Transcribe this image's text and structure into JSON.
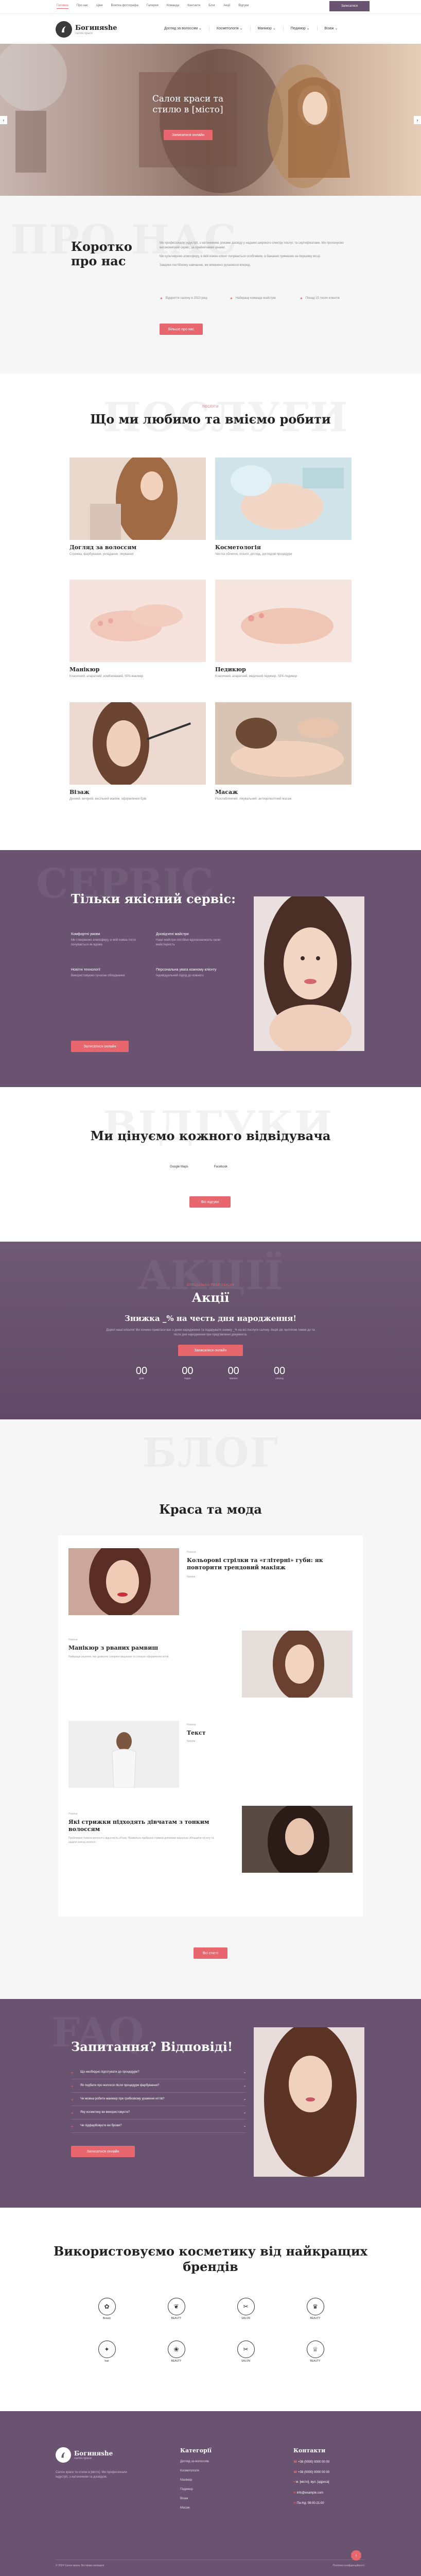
{
  "top_bar": {
    "links": [
      "Головна",
      "Про нас",
      "Ціни",
      "Візитка фотографа",
      "Галерея",
      "Команда",
      "Контакти",
      "Блог",
      "Акції",
      "Відгуки"
    ],
    "button": "Записатися"
  },
  "header": {
    "logo_name": "Богиняshe",
    "logo_sub": "салон краси",
    "nav": [
      "Догляд за волоссям",
      "Косметологія",
      "Манікюр",
      "Педикюр",
      "Візаж"
    ]
  },
  "hero": {
    "title_line1": "Салон краси та",
    "title_line2": "стилю в [місто]",
    "button": "Записатися онлайн"
  },
  "about": {
    "ghost": "ПРО НАС",
    "title_line1": "Коротко",
    "title_line2": "про нас",
    "p1": "Ми професіонали індустрії, з натхненням, роками досвіду у наданні широкого спектру послуг, та сертифікатами. Ми пропонуємо високоякісний сервіс, за прийнятними цінами.",
    "p2": "Ми культивуємо атмосферу, в якій кожен клієнт почувається особливим, а бажання тримаємо на першому місці.",
    "p3": "Завдяки постійному навчанню, ми впевнено рухаємося вперед.",
    "features": [
      "Відкриття салону в 2010 році",
      "Найкращі команда майстрів",
      "Понад 15 тисяч клієнтів"
    ],
    "button": "Більше про нас"
  },
  "services": {
    "ghost": "ПОСЛУГИ",
    "label": "Послуги",
    "title": "Що ми любимо та вміємо робити",
    "items": [
      {
        "title": "Догляд за волоссям",
        "desc": "Стрижка, фарбування, укладання, лікування"
      },
      {
        "title": "Косметологія",
        "desc": "Чистка обличчя, пілінги, догляд, доглядові процедури"
      },
      {
        "title": "Манікюр",
        "desc": "Класичний, апаратний, комбінований, SPA-манікюр"
      },
      {
        "title": "Педикюр",
        "desc": "Класичний, апаратний, медичний педикюр, SPA-педикюр"
      },
      {
        "title": "Візаж",
        "desc": "Денний, вечірній, весільний макіяж, оформлення брів"
      },
      {
        "title": "Масаж",
        "desc": "Розслабляючий, лікувальний, антицелюлітний масаж"
      }
    ]
  },
  "quality": {
    "ghost": "СЕРВІС",
    "title": "Тільки якісний сервіс:",
    "items": [
      {
        "title": "Комфортні умови",
        "desc": "Ми створюємо атмосферу, в якій кожна гостя почувається як вдома"
      },
      {
        "title": "Досвідчені майстри",
        "desc": "Наші майстри постійно вдосконалюють свою майстерність"
      },
      {
        "title": "Новітні технології",
        "desc": "Використовуємо сучасне обладнання"
      },
      {
        "title": "Персональна увага кожному клієнту",
        "desc": "Індивідуальний підхід до кожного"
      }
    ],
    "button": "Записатися онлайн"
  },
  "reviews": {
    "ghost": "ВІДГУКИ",
    "title": "Ми цінуємо кожного відвідувача",
    "tabs": [
      "Google Maps",
      "Facebook"
    ],
    "button": "Всі відгуки"
  },
  "promo": {
    "ghost": "АКЦІЇ",
    "label": "Спеціальна пропозиція",
    "title": "Акції",
    "subtitle": "Знижка _% на честь дня народження!",
    "text": "Дорогі наші клієнти! Ми хочемо привітати вас з днем народження та подарувати знижку _% на всі послуги салону. Акція діє протягом тижня до та після дня народження при пред'явленні документа.",
    "button": "Записатися онлайн",
    "counters": [
      {
        "value": "00",
        "label": "днів"
      },
      {
        "value": "00",
        "label": "годин"
      },
      {
        "value": "00",
        "label": "хвилин"
      },
      {
        "value": "00",
        "label": "секунд"
      }
    ]
  },
  "blog": {
    "ghost": "БЛОГ",
    "title": "Краса та мода",
    "posts": [
      {
        "date": "Новини",
        "title": "Кольорові стрілки та «глітерні» губи: як повторити трендовий макіяж",
        "excerpt": "Читати"
      },
      {
        "date": "Новини",
        "title": "Манікюр з рваних рамвиш",
        "excerpt": "Найкраще рішення, яке дозволяє створити вишукане та стильне оформлення нігтів."
      },
      {
        "date": "Новини",
        "title": "Текст",
        "excerpt": "Читати"
      },
      {
        "date": "Новини",
        "title": "Які стрижки підходять дівчатам з тонким волоссям",
        "excerpt": "Проблемою тонкого волосся є відсутність об'єму. Правильно підібрана стрижка допоможе візуально збільшити густоту та надати зачісці легкості."
      }
    ],
    "button": "Всі статті"
  },
  "faq": {
    "ghost": "FAQ",
    "title": "Запитання? Відповіді!",
    "items": [
      "Що необхідно підготувати до процедури?",
      "Як подбати про волосся після процедури фарбування?",
      "Чи можна робити манікюр при грибковому ураженні нігтів?",
      "Яку косметику ви використовуєте?",
      "Чи підфарбовуєте ви брови?"
    ],
    "button": "Записатися онлайн"
  },
  "brands": {
    "title_line1": "Використовуємо косметику від найкращих",
    "title_line2": "брендів",
    "items": [
      "Beauty",
      "BEAUTY",
      "SALON",
      "BEAUTY",
      "hair",
      "BEAUTY",
      "SALON",
      "BEAUTY"
    ]
  },
  "footer": {
    "logo_name": "Богиняshe",
    "logo_sub": "салон краси",
    "about": "Салон краси та стилю в [місто]. Ми професіонали індустрії, з натхненням та досвідом.",
    "cat_title": "Категорії",
    "categories": [
      "Догляд за волоссям",
      "Косметологія",
      "Манікюр",
      "Педикюр",
      "Візаж",
      "Масаж"
    ],
    "contacts_title": "Контакти",
    "contacts": [
      "+38 (0000) 0000 00 00",
      "+38 (0000) 0000 00 00",
      "м. [місто], вул. [адреса]",
      "info@example.com",
      "Пн-Нд: 09:00-21:00"
    ],
    "copyright": "© 2024 Салон краси. Всі права захищені",
    "privacy": "Політика конфіденційності"
  },
  "colors": {
    "accent": "#e8676f",
    "purple": "#6a5370",
    "purple_dark": "#5c4762"
  }
}
